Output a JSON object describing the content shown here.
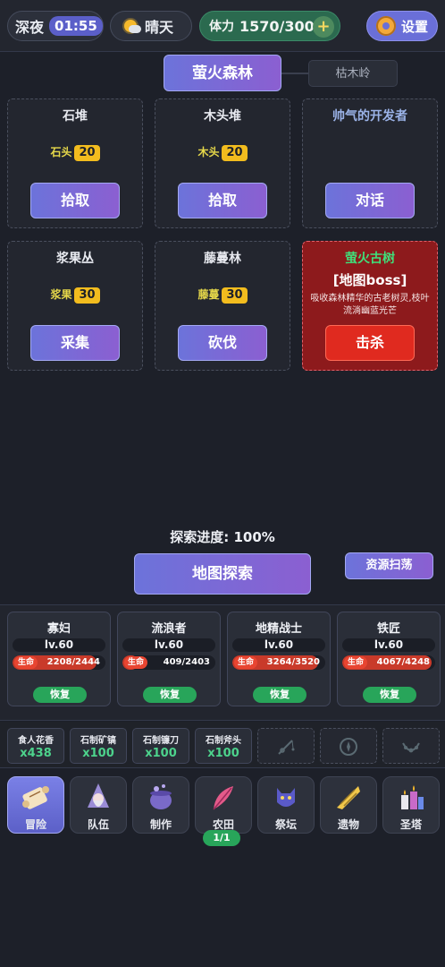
{
  "topbar": {
    "phase": "深夜",
    "clock": "01:55",
    "weather": "晴天",
    "stamina_label": "体力",
    "stamina_value": "1570/300",
    "stamina_add": "+",
    "settings_label": "设置"
  },
  "location": {
    "current": "萤火森林",
    "other": "枯木岭"
  },
  "cards": [
    {
      "title": "石堆",
      "resource": "石头",
      "count": "20",
      "action": "拾取"
    },
    {
      "title": "木头堆",
      "resource": "木头",
      "count": "20",
      "action": "拾取"
    },
    {
      "title": "帅气的开发者",
      "action": "对话"
    },
    {
      "title": "浆果丛",
      "resource": "浆果",
      "count": "30",
      "action": "采集"
    },
    {
      "title": "藤蔓林",
      "resource": "藤蔓",
      "count": "30",
      "action": "砍伐"
    }
  ],
  "boss": {
    "name": "萤火古树",
    "tag": "[地图boss]",
    "desc": "吸收森林精华的古老树灵,枝叶流淌幽蓝光芒",
    "action": "击杀"
  },
  "explore": {
    "progress_text": "探索进度: 100%",
    "explore_button": "地图探索",
    "sweep_button": "资源扫荡"
  },
  "team": [
    {
      "name": "寡妇",
      "level": "lv.60",
      "hp_label": "生命",
      "hp_text": "2208/2444",
      "hp_current": 2208,
      "hp_max": 2444,
      "heal": "恢复"
    },
    {
      "name": "流浪者",
      "level": "lv.60",
      "hp_label": "生命",
      "hp_text": "409/2403",
      "hp_current": 409,
      "hp_max": 2403,
      "heal": "恢复"
    },
    {
      "name": "地精战士",
      "level": "lv.60",
      "hp_label": "生命",
      "hp_text": "3264/3520",
      "hp_current": 3264,
      "hp_max": 3520,
      "heal": "恢复"
    },
    {
      "name": "铁匠",
      "level": "lv.60",
      "hp_label": "生命",
      "hp_text": "4067/4248",
      "hp_current": 4067,
      "hp_max": 4248,
      "heal": "恢复"
    }
  ],
  "inventory": [
    {
      "name": "食人花香",
      "qty": "x438"
    },
    {
      "name": "石制矿镐",
      "qty": "x100"
    },
    {
      "name": "石制镰刀",
      "qty": "x100"
    },
    {
      "name": "石制斧头",
      "qty": "x100"
    }
  ],
  "empty_slots": [
    "fishing-rod-icon",
    "compass-icon",
    "necklace-icon"
  ],
  "nav": [
    {
      "label": "冒险",
      "icon": "scroll-icon",
      "active": true
    },
    {
      "label": "队伍",
      "icon": "wizard-icon"
    },
    {
      "label": "制作",
      "icon": "cauldron-icon"
    },
    {
      "label": "农田",
      "icon": "feather-icon"
    },
    {
      "label": "祭坛",
      "icon": "cat-icon"
    },
    {
      "label": "遗物",
      "icon": "shell-icon"
    },
    {
      "label": "圣塔",
      "icon": "candles-icon"
    }
  ],
  "farm_badge": "1/1",
  "colors": {
    "accent": "#6c73da",
    "boss_red": "#8d1a1c",
    "kill_red": "#e02a1f",
    "heal_green": "#28a55a",
    "count_yellow": "#f2bc1e"
  }
}
